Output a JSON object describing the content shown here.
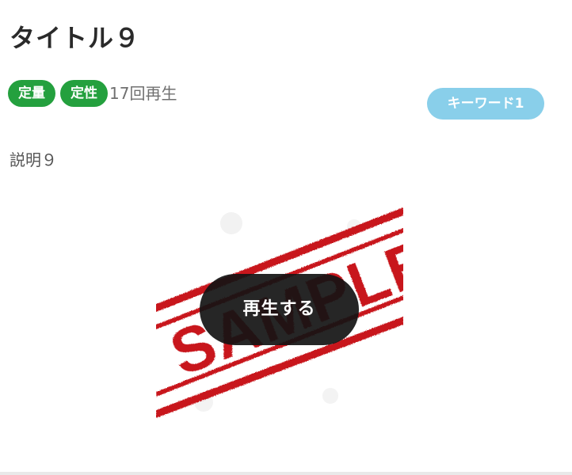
{
  "card": {
    "title": "タイトル９",
    "tags": [
      "定量",
      "定性"
    ],
    "play_count": "17回再生",
    "keywords": [
      "キーワード1"
    ],
    "description": "説明９",
    "thumbnail": {
      "watermark_text": "SAMPLE",
      "stamp_color": "#c8141b"
    },
    "play_button_label": "再生する"
  },
  "colors": {
    "tag_green": "#24a03e",
    "keyword_blue": "#89cfea",
    "play_button_bg": "#141414"
  }
}
